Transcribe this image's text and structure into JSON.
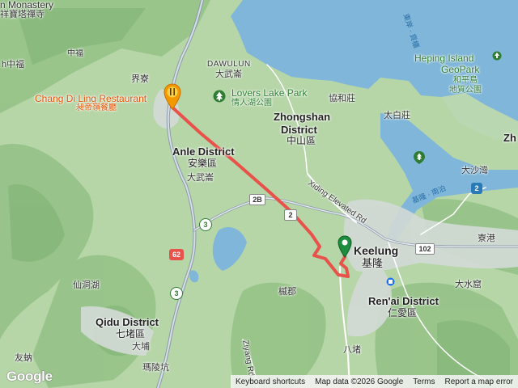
{
  "map": {
    "colors": {
      "sea": "#7fb6d9",
      "land_low": "#b9d9ad",
      "land_high": "#8fbf85",
      "urban": "#d5dcdc",
      "route": "#e8524a",
      "highway": "#8a9aab"
    },
    "labels": {
      "monastery": "n Monastery",
      "monastery_zh": "祥寶塔禪寺",
      "zhongfu_zh": "中福",
      "zhongfu2_zh": "h中福",
      "dawulun": "DAWULUN",
      "dawulun_zh": "大武崙",
      "jieliao_zh": "界寮",
      "lovers_lake": "Lovers Lake Park",
      "lovers_lake_zh": "情人湖公園",
      "xiehezhuang_zh": "協和莊",
      "zhongshan": "Zhongshan",
      "district_word": "District",
      "zhongshan_zh": "中山區",
      "taibaizhuang_zh": "太白莊",
      "heping_island": "Heping Island",
      "geopark": "GeoPark",
      "heping_zh": "和平島",
      "geopark_zh": "地質公園",
      "restaurant": "Chang Di Ling Restaurant",
      "restaurant_zh": "昶帝嶺餐廳",
      "anle": "Anle District",
      "anle_zh": "安樂區",
      "dawulun2_zh": "大武崙",
      "xiding": "Xiding Elevated Rd",
      "keelung": "Keelung",
      "keelung_zh": "基隆",
      "dashawan_zh": "大沙灣",
      "liaogang_zh": "寮港",
      "xiandong_zh": "仙洞湖",
      "nuanjun_zh": "槭郡",
      "renai": "Ren'ai District",
      "renai_zh": "仁愛區",
      "dashuiku_zh": "大水窟",
      "qidu": "Qidu District",
      "qidu_zh": "七堵區",
      "dapu_zh": "大埔",
      "youbao_zh": "友蚋",
      "malingkeng_zh": "瑪陵坑",
      "badu_zh": "八堵",
      "ziyang": "Ziyang Rd",
      "zh_edge": "Zh",
      "east_channel": "東岸 · 貨櫃",
      "keelung_port": "基隆 · 南泊",
      "shield_62": "62",
      "shield_2": "2",
      "shield_2b": "2",
      "shield_3": "3",
      "shield_3b": "3",
      "shield_102": "102",
      "shield_2b_tw": "2B"
    },
    "logo": "Google",
    "attribution": {
      "shortcuts": "Keyboard shortcuts",
      "data": "Map data ©2026 Google",
      "terms": "Terms",
      "report": "Report a map error"
    }
  }
}
